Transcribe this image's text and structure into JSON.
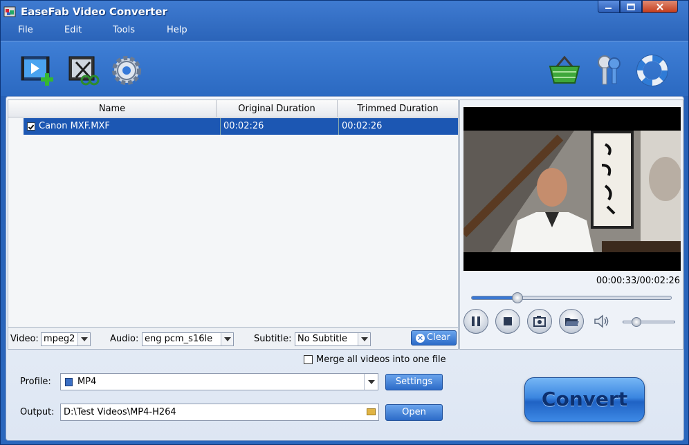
{
  "window": {
    "title": "EaseFab Video Converter"
  },
  "menu": {
    "file": "File",
    "edit": "Edit",
    "tools": "Tools",
    "help": "Help"
  },
  "toolbar": {
    "icons": [
      "add-video-icon",
      "edit-video-icon",
      "gear-icon",
      "basket-icon",
      "keys-icon",
      "lifebuoy-icon"
    ]
  },
  "file_list": {
    "columns": [
      "Name",
      "Original Duration",
      "Trimmed Duration"
    ],
    "rows": [
      {
        "checked": true,
        "name": "Canon MXF.MXF",
        "original": "00:02:26",
        "trimmed": "00:02:26"
      }
    ]
  },
  "tracks": {
    "video_label": "Video:",
    "video_value": "mpeg2",
    "audio_label": "Audio:",
    "audio_value": "eng pcm_s16le",
    "subtitle_label": "Subtitle:",
    "subtitle_value": "No Subtitle",
    "clear_label": "Clear"
  },
  "preview": {
    "timecode": "00:00:33/00:02:26",
    "seek_fraction": 0.23,
    "volume_fraction": 0.25
  },
  "options": {
    "merge_label": "Merge all videos into one file",
    "merge_checked": false
  },
  "profile": {
    "label": "Profile:",
    "value": "MP4",
    "settings_label": "Settings"
  },
  "output": {
    "label": "Output:",
    "value": "D:\\Test Videos\\MP4-H264",
    "open_label": "Open"
  },
  "convert": {
    "label": "Convert"
  }
}
